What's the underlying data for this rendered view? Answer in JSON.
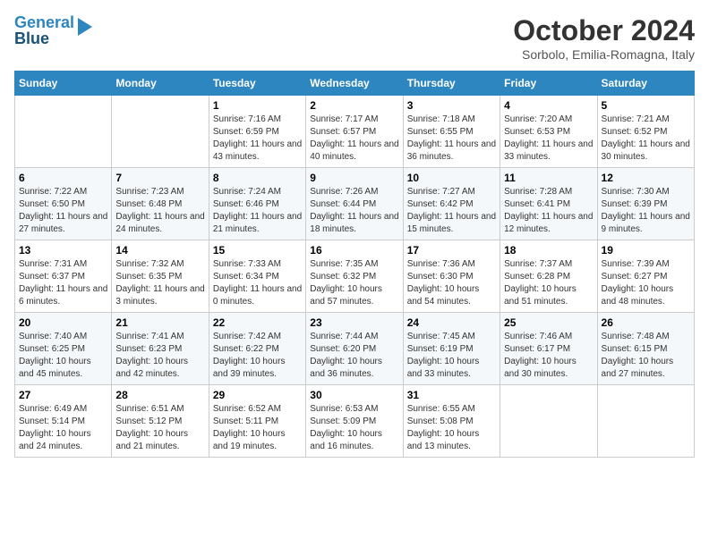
{
  "header": {
    "logo_line1": "General",
    "logo_line2": "Blue",
    "title": "October 2024",
    "subtitle": "Sorbolo, Emilia-Romagna, Italy"
  },
  "calendar": {
    "days_of_week": [
      "Sunday",
      "Monday",
      "Tuesday",
      "Wednesday",
      "Thursday",
      "Friday",
      "Saturday"
    ],
    "weeks": [
      [
        {
          "day": "",
          "info": ""
        },
        {
          "day": "",
          "info": ""
        },
        {
          "day": "1",
          "info": "Sunrise: 7:16 AM\nSunset: 6:59 PM\nDaylight: 11 hours and 43 minutes."
        },
        {
          "day": "2",
          "info": "Sunrise: 7:17 AM\nSunset: 6:57 PM\nDaylight: 11 hours and 40 minutes."
        },
        {
          "day": "3",
          "info": "Sunrise: 7:18 AM\nSunset: 6:55 PM\nDaylight: 11 hours and 36 minutes."
        },
        {
          "day": "4",
          "info": "Sunrise: 7:20 AM\nSunset: 6:53 PM\nDaylight: 11 hours and 33 minutes."
        },
        {
          "day": "5",
          "info": "Sunrise: 7:21 AM\nSunset: 6:52 PM\nDaylight: 11 hours and 30 minutes."
        }
      ],
      [
        {
          "day": "6",
          "info": "Sunrise: 7:22 AM\nSunset: 6:50 PM\nDaylight: 11 hours and 27 minutes."
        },
        {
          "day": "7",
          "info": "Sunrise: 7:23 AM\nSunset: 6:48 PM\nDaylight: 11 hours and 24 minutes."
        },
        {
          "day": "8",
          "info": "Sunrise: 7:24 AM\nSunset: 6:46 PM\nDaylight: 11 hours and 21 minutes."
        },
        {
          "day": "9",
          "info": "Sunrise: 7:26 AM\nSunset: 6:44 PM\nDaylight: 11 hours and 18 minutes."
        },
        {
          "day": "10",
          "info": "Sunrise: 7:27 AM\nSunset: 6:42 PM\nDaylight: 11 hours and 15 minutes."
        },
        {
          "day": "11",
          "info": "Sunrise: 7:28 AM\nSunset: 6:41 PM\nDaylight: 11 hours and 12 minutes."
        },
        {
          "day": "12",
          "info": "Sunrise: 7:30 AM\nSunset: 6:39 PM\nDaylight: 11 hours and 9 minutes."
        }
      ],
      [
        {
          "day": "13",
          "info": "Sunrise: 7:31 AM\nSunset: 6:37 PM\nDaylight: 11 hours and 6 minutes."
        },
        {
          "day": "14",
          "info": "Sunrise: 7:32 AM\nSunset: 6:35 PM\nDaylight: 11 hours and 3 minutes."
        },
        {
          "day": "15",
          "info": "Sunrise: 7:33 AM\nSunset: 6:34 PM\nDaylight: 11 hours and 0 minutes."
        },
        {
          "day": "16",
          "info": "Sunrise: 7:35 AM\nSunset: 6:32 PM\nDaylight: 10 hours and 57 minutes."
        },
        {
          "day": "17",
          "info": "Sunrise: 7:36 AM\nSunset: 6:30 PM\nDaylight: 10 hours and 54 minutes."
        },
        {
          "day": "18",
          "info": "Sunrise: 7:37 AM\nSunset: 6:28 PM\nDaylight: 10 hours and 51 minutes."
        },
        {
          "day": "19",
          "info": "Sunrise: 7:39 AM\nSunset: 6:27 PM\nDaylight: 10 hours and 48 minutes."
        }
      ],
      [
        {
          "day": "20",
          "info": "Sunrise: 7:40 AM\nSunset: 6:25 PM\nDaylight: 10 hours and 45 minutes."
        },
        {
          "day": "21",
          "info": "Sunrise: 7:41 AM\nSunset: 6:23 PM\nDaylight: 10 hours and 42 minutes."
        },
        {
          "day": "22",
          "info": "Sunrise: 7:42 AM\nSunset: 6:22 PM\nDaylight: 10 hours and 39 minutes."
        },
        {
          "day": "23",
          "info": "Sunrise: 7:44 AM\nSunset: 6:20 PM\nDaylight: 10 hours and 36 minutes."
        },
        {
          "day": "24",
          "info": "Sunrise: 7:45 AM\nSunset: 6:19 PM\nDaylight: 10 hours and 33 minutes."
        },
        {
          "day": "25",
          "info": "Sunrise: 7:46 AM\nSunset: 6:17 PM\nDaylight: 10 hours and 30 minutes."
        },
        {
          "day": "26",
          "info": "Sunrise: 7:48 AM\nSunset: 6:15 PM\nDaylight: 10 hours and 27 minutes."
        }
      ],
      [
        {
          "day": "27",
          "info": "Sunrise: 6:49 AM\nSunset: 5:14 PM\nDaylight: 10 hours and 24 minutes."
        },
        {
          "day": "28",
          "info": "Sunrise: 6:51 AM\nSunset: 5:12 PM\nDaylight: 10 hours and 21 minutes."
        },
        {
          "day": "29",
          "info": "Sunrise: 6:52 AM\nSunset: 5:11 PM\nDaylight: 10 hours and 19 minutes."
        },
        {
          "day": "30",
          "info": "Sunrise: 6:53 AM\nSunset: 5:09 PM\nDaylight: 10 hours and 16 minutes."
        },
        {
          "day": "31",
          "info": "Sunrise: 6:55 AM\nSunset: 5:08 PM\nDaylight: 10 hours and 13 minutes."
        },
        {
          "day": "",
          "info": ""
        },
        {
          "day": "",
          "info": ""
        }
      ]
    ]
  }
}
